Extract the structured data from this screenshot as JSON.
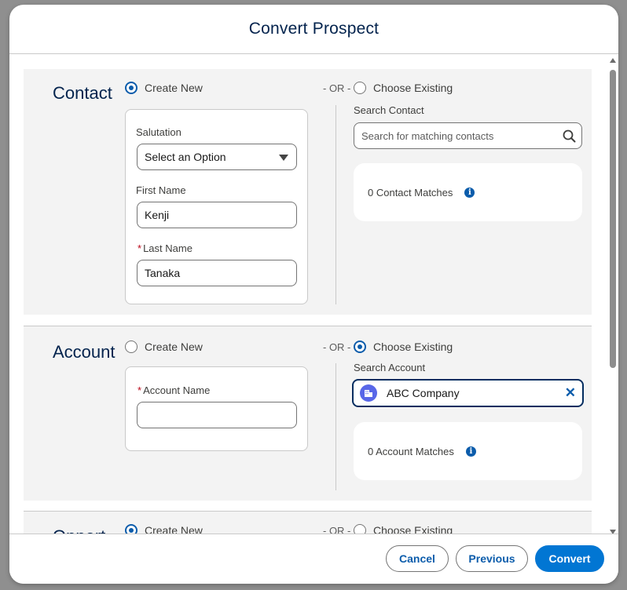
{
  "modal": {
    "title": "Convert Prospect"
  },
  "contact": {
    "title": "Contact",
    "create_new_label": "Create New",
    "or_label": "- OR -",
    "choose_existing_label": "Choose Existing",
    "create_new_selected": true,
    "salutation_label": "Salutation",
    "salutation_value": "Select an Option",
    "first_name_label": "First Name",
    "first_name_value": "Kenji",
    "last_name_required": "*",
    "last_name_label": "Last Name",
    "last_name_value": "Tanaka",
    "search_label": "Search Contact",
    "search_placeholder": "Search for matching contacts",
    "matches_text": "0 Contact Matches"
  },
  "account": {
    "title": "Account",
    "create_new_label": "Create New",
    "or_label": "- OR -",
    "choose_existing_label": "Choose Existing",
    "choose_existing_selected": true,
    "account_name_required": "*",
    "account_name_label": "Account Name",
    "account_name_value": "",
    "search_label": "Search Account",
    "selected_account": "ABC Company",
    "matches_text": "0 Account Matches"
  },
  "opportunity": {
    "title": "Opport",
    "create_new_label": "Create New",
    "or_label": "- OR -",
    "choose_existing_label": "Choose Existing"
  },
  "footer": {
    "cancel_label": "Cancel",
    "previous_label": "Previous",
    "convert_label": "Convert"
  },
  "colors": {
    "brand": "#0176d3",
    "title_navy": "#03234d",
    "link_blue": "#0b5cab",
    "required_red": "#ba0517",
    "account_icon": "#5867e8"
  },
  "icons": {
    "search": "search-icon",
    "info": "info-icon",
    "account": "account-icon",
    "clear": "close-icon",
    "dropdown": "chevron-down-icon"
  }
}
